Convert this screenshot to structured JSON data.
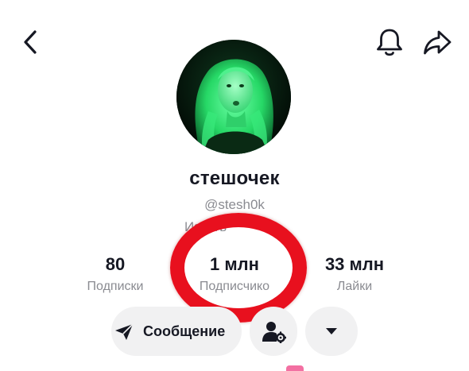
{
  "header": {
    "back_icon": "chevron-left-icon",
    "notification_icon": "bell-icon",
    "share_icon": "share-arrow-icon"
  },
  "profile": {
    "display_name": "стешочек",
    "username": "@stesh0k",
    "edit_profile_visible": "Изм          ть"
  },
  "stats": [
    {
      "value": "80",
      "label": "Подписки"
    },
    {
      "value": "1 млн",
      "label": "Подписчико"
    },
    {
      "value": "33 млн",
      "label": "Лайки"
    }
  ],
  "actions": {
    "message_label": "Сообщение",
    "message_icon": "send-arrow-icon",
    "add_friend_icon": "person-gear-icon",
    "more_icon": "caret-down-icon"
  },
  "colors": {
    "highlight_ring": "#e8101e",
    "button_bg": "#f1f1f2",
    "secondary_text": "#8a8b91",
    "avatar_tint": "#2dff7a"
  }
}
